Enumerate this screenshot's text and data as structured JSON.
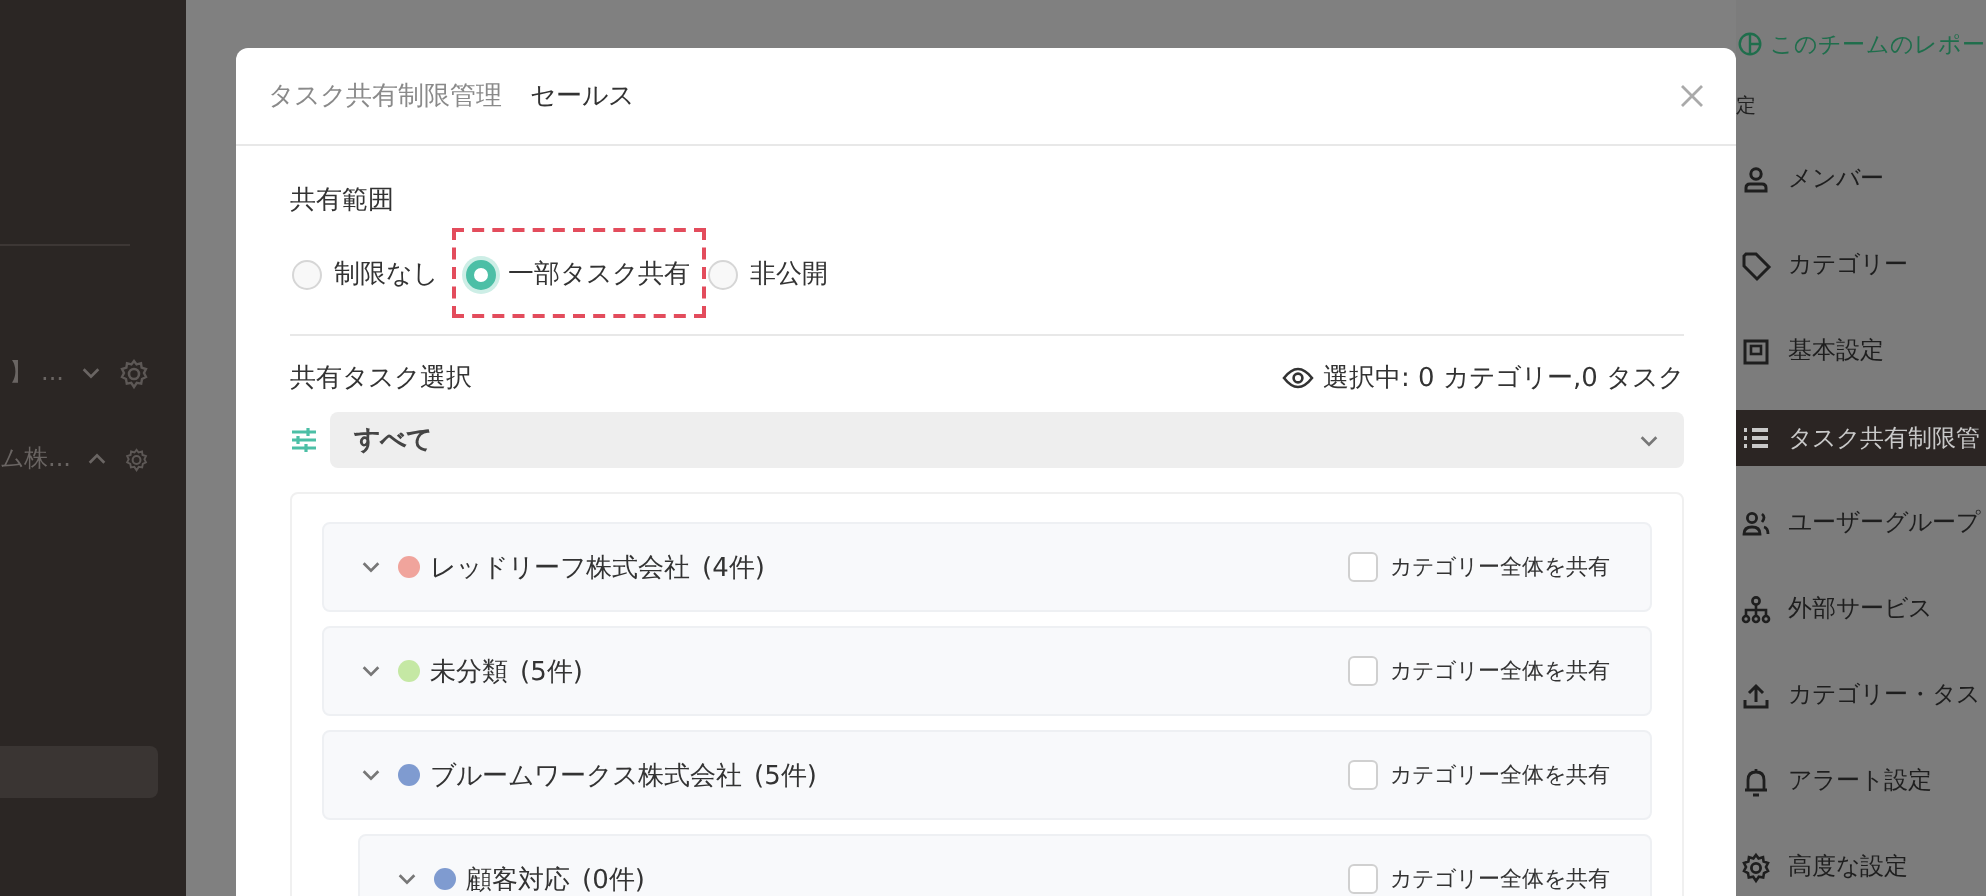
{
  "left_sidebar": {
    "items": [
      {
        "label": "】 ...",
        "expanded": false
      },
      {
        "label": "ム株...",
        "expanded": true
      }
    ]
  },
  "right_sidebar": {
    "report_link": "このチームのレポー",
    "section_label": "定",
    "items": [
      {
        "kind": "person",
        "label": "メンバー",
        "selected": false
      },
      {
        "kind": "tag",
        "label": "カテゴリー",
        "selected": false
      },
      {
        "kind": "box",
        "label": "基本設定",
        "selected": false
      },
      {
        "kind": "list",
        "label": "タスク共有制限管",
        "selected": true
      },
      {
        "kind": "group",
        "label": "ユーザーグループ",
        "selected": false
      },
      {
        "kind": "tree",
        "label": "外部サービス",
        "selected": false
      },
      {
        "kind": "upload",
        "label": "カテゴリー・タス",
        "selected": false
      },
      {
        "kind": "bell",
        "label": "アラート設定",
        "selected": false
      },
      {
        "kind": "gear",
        "label": "高度な設定",
        "selected": false
      }
    ]
  },
  "dialog": {
    "title": "タスク共有制限管理",
    "subtitle": "セールス",
    "sharing_scope": {
      "label": "共有範囲",
      "options": [
        {
          "label": "制限なし",
          "selected": false
        },
        {
          "label": "一部タスク共有",
          "selected": true
        },
        {
          "label": "非公開",
          "selected": false
        }
      ]
    },
    "task_selection": {
      "label": "共有タスク選択",
      "summary": "選択中: 0 カテゴリー,0 タスク",
      "filter": {
        "value": "すべて"
      }
    },
    "categories": [
      {
        "name": "レッドリーフ株式会社",
        "count": "(4件)",
        "color": "#f0a49c",
        "checked": false,
        "checkbox_label": "カテゴリー全体を共有"
      },
      {
        "name": "未分類",
        "count": "(5件)",
        "color": "#c5e8a4",
        "checked": false,
        "checkbox_label": "カテゴリー全体を共有"
      },
      {
        "name": "ブルームワークス株式会社",
        "count": "(5件)",
        "color": "#7f9bd0",
        "checked": false,
        "checkbox_label": "カテゴリー全体を共有",
        "children": [
          {
            "name": "顧客対応",
            "count": "(0件)",
            "color": "#7f9bd0",
            "checked": false,
            "checkbox_label": "カテゴリー全体を共有"
          }
        ]
      }
    ]
  }
}
